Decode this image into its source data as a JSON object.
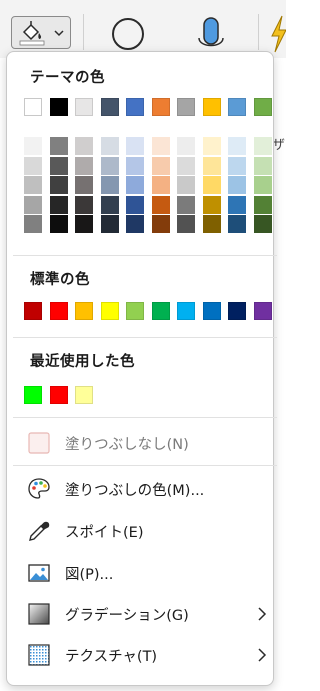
{
  "ribbon": {
    "fill_button_icon": "paint-bucket-icon",
    "fill_button_chevron": "chevron-down-icon",
    "cut_text": "ザ"
  },
  "panel": {
    "theme_heading": "テーマの色",
    "standard_heading": "標準の色",
    "recent_heading": "最近使用した色",
    "theme_colors": [
      "#ffffff",
      "#000000",
      "#e7e6e6",
      "#44546a",
      "#4472c4",
      "#ed7d31",
      "#a5a5a5",
      "#ffc000",
      "#5b9bd5",
      "#70ad47"
    ],
    "theme_shades": [
      [
        "#f2f2f2",
        "#d9d9d9",
        "#bfbfbf",
        "#a6a6a6",
        "#808080"
      ],
      [
        "#808080",
        "#595959",
        "#404040",
        "#262626",
        "#0d0d0d"
      ],
      [
        "#d0cece",
        "#afabab",
        "#767171",
        "#3b3838",
        "#181717"
      ],
      [
        "#d6dce4",
        "#adb9ca",
        "#8497b0",
        "#323f4f",
        "#222a35"
      ],
      [
        "#d9e2f3",
        "#b4c6e7",
        "#8eaadb",
        "#2f5496",
        "#1f3864"
      ],
      [
        "#fbe5d5",
        "#f7cbac",
        "#f4b183",
        "#c55a11",
        "#833c0b"
      ],
      [
        "#ededed",
        "#dbdbdb",
        "#c9c9c9",
        "#7b7b7b",
        "#525252"
      ],
      [
        "#fff2cc",
        "#fee599",
        "#ffd965",
        "#bf9000",
        "#7f6000"
      ],
      [
        "#deebf6",
        "#bdd7ee",
        "#9cc3e5",
        "#2e75b5",
        "#1e4e79"
      ],
      [
        "#e2efd9",
        "#c5e0b3",
        "#a8d08d",
        "#538135",
        "#375623"
      ]
    ],
    "standard_colors": [
      "#c00000",
      "#ff0000",
      "#ffc000",
      "#ffff00",
      "#92d050",
      "#00b050",
      "#00b0f0",
      "#0070c0",
      "#002060",
      "#7030a0"
    ],
    "recent_colors": [
      "#00ff00",
      "#ff0000",
      "#ffff99"
    ],
    "no_fill": {
      "label": "塗りつぶしなし(N)",
      "icon": "no-fill-square-icon"
    },
    "more_colors": {
      "label": "塗りつぶしの色(M)...",
      "icon": "palette-icon"
    },
    "eyedropper": {
      "label": "スポイト(E)",
      "icon": "eyedropper-icon"
    },
    "picture": {
      "label": "図(P)...",
      "icon": "picture-icon"
    },
    "gradient": {
      "label": "グラデーション(G)",
      "icon": "gradient-icon",
      "submenu_icon": "chevron-right-icon"
    },
    "texture": {
      "label": "テクスチャ(T)",
      "icon": "texture-icon",
      "submenu_icon": "chevron-right-icon"
    }
  }
}
